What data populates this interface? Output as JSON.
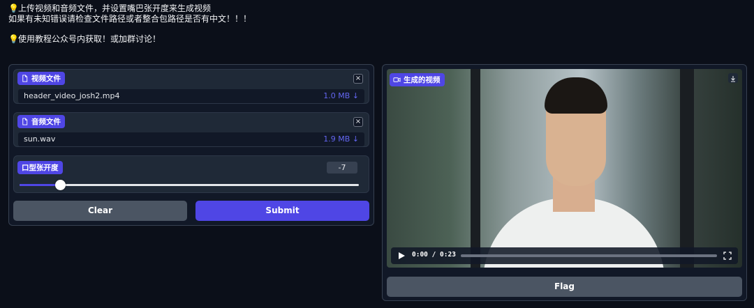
{
  "notes": {
    "line1": "上传视频和音频文件，并设置嘴巴张开度来生成视频",
    "line2": "如果有未知错误请检查文件路径或者整合包路径是否有中文！！！",
    "line3": "使用教程公众号内获取！或加群讨论！"
  },
  "video_input": {
    "label": "视频文件",
    "file_name": "header_video_josh2.mp4",
    "file_size": "1.0 MB ↓",
    "close": "×"
  },
  "audio_input": {
    "label": "音频文件",
    "file_name": "sun.wav",
    "file_size": "1.9 MB ↓",
    "close": "×"
  },
  "mouth_slider": {
    "label": "口型张开度",
    "value": "-7",
    "fraction": 0.12
  },
  "buttons": {
    "clear": "Clear",
    "submit": "Submit",
    "flag": "Flag"
  },
  "output_video": {
    "label": "生成的视频",
    "time": "0:00 / 0:23",
    "progress": 0
  },
  "icons": {
    "bulb": "lightbulb-icon",
    "file": "file-icon",
    "video": "video-icon",
    "download": "download-icon",
    "play": "play-icon",
    "fullscreen": "fullscreen-icon"
  },
  "colors": {
    "accent": "#4f46e5",
    "background": "#0b0f19",
    "panel": "#111827",
    "secondary_button": "#4b5563"
  }
}
